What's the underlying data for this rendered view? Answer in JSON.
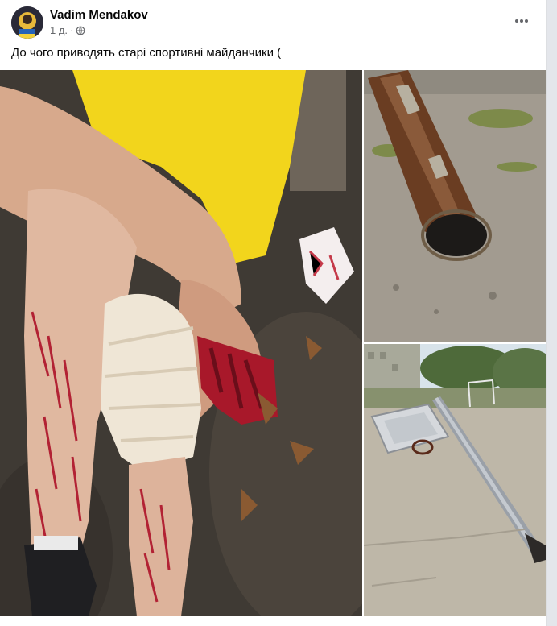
{
  "post": {
    "author": "Vadim Mendakov",
    "timestamp": "1 д.",
    "separator": "·",
    "privacy_icon": "globe-icon",
    "more_icon": "more-horizontal-icon",
    "caption": "До чого приводять старі спортивні майданчики ("
  },
  "photos": [
    {
      "subject": "injured-legs-and-hand"
    },
    {
      "subject": "rusty-pipe-in-ground"
    },
    {
      "subject": "fallen-basketball-hoop"
    }
  ],
  "colors": {
    "author_text": "#050505",
    "meta_text": "#65676b",
    "page_bg": "#f0f2f5",
    "card_bg": "#ffffff"
  }
}
